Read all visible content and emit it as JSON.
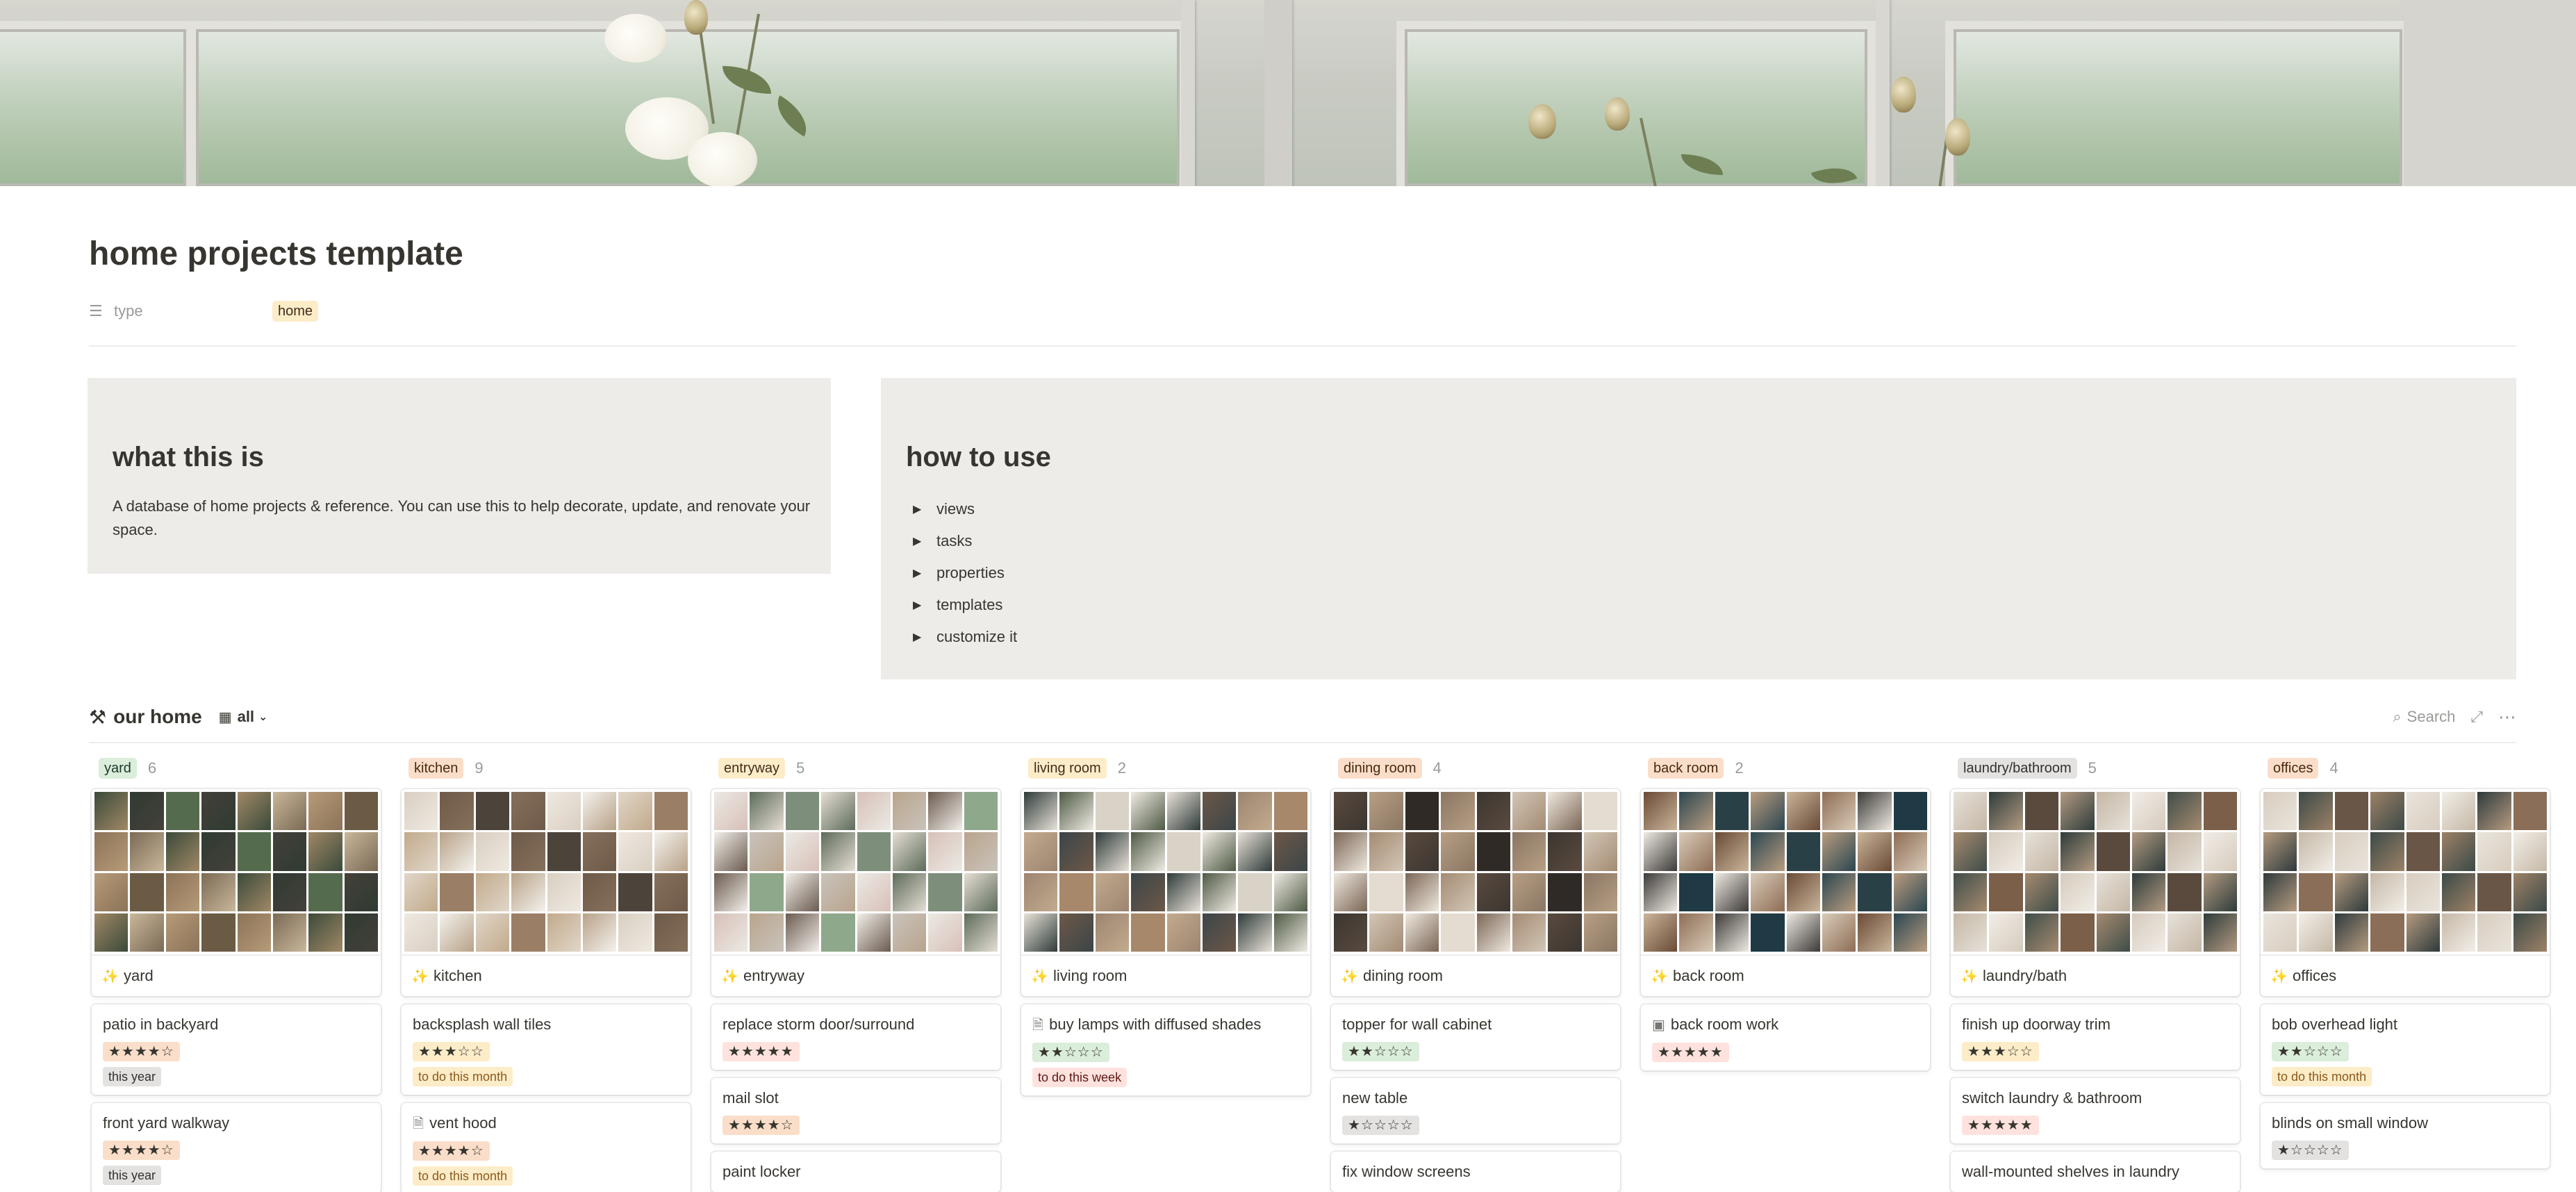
{
  "page": {
    "title": "home projects template",
    "property": {
      "label": "type",
      "value": "home",
      "icon": "list-icon"
    }
  },
  "what_this_is": {
    "heading": "what this is",
    "body": "A database of home projects & reference. You can use this to help decorate, update, and renovate your space."
  },
  "how_to_use": {
    "heading": "how to use",
    "items": [
      "views",
      "tasks",
      "properties",
      "templates",
      "customize it"
    ]
  },
  "database": {
    "title": "our home",
    "icon": "wrench-icon",
    "view_label": "all",
    "search_label": "Search",
    "columns": [
      {
        "name": "yard",
        "count": "6",
        "color": "#dbeddb",
        "text_color": "#1c3829",
        "card_title": "yard",
        "tasks": [
          {
            "name": "patio in backyard",
            "stars": "★★★★☆",
            "star_bg": "#fadec9",
            "badge": "this year",
            "badge_bg": "#e3e2e0",
            "badge_color": "#32302c"
          },
          {
            "name": "front yard walkway",
            "stars": "★★★★☆",
            "star_bg": "#fadec9",
            "badge": "this year",
            "badge_bg": "#e3e2e0",
            "badge_color": "#32302c"
          }
        ]
      },
      {
        "name": "kitchen",
        "count": "9",
        "color": "#fadec9",
        "text_color": "#49290e",
        "card_title": "kitchen",
        "tasks": [
          {
            "name": "backsplash wall tiles",
            "stars": "★★★☆☆",
            "star_bg": "#fdecc8",
            "badge": "to do this month",
            "badge_bg": "#fdecc8",
            "badge_color": "#8a5a1c"
          },
          {
            "name": "vent hood",
            "page_icon": "page-icon",
            "stars": "★★★★☆",
            "star_bg": "#fadec9",
            "badge": "to do this month",
            "badge_bg": "#fdecc8",
            "badge_color": "#8a5a1c"
          }
        ]
      },
      {
        "name": "entryway",
        "count": "5",
        "color": "#fdecc8",
        "text_color": "#402c1b",
        "card_title": "entryway",
        "tasks": [
          {
            "name": "replace storm door/surround",
            "stars": "★★★★★",
            "star_bg": "#ffe2dd",
            "badge": "",
            "badge_bg": "",
            "badge_color": ""
          },
          {
            "name": "mail slot",
            "stars": "★★★★☆",
            "star_bg": "#fadec9",
            "badge": "",
            "badge_bg": "",
            "badge_color": ""
          },
          {
            "name": "paint locker",
            "stars": "",
            "star_bg": "",
            "badge": "",
            "badge_bg": "",
            "badge_color": ""
          }
        ]
      },
      {
        "name": "living room",
        "count": "2",
        "color": "#fdecc8",
        "text_color": "#402c1b",
        "card_title": "living room",
        "tasks": [
          {
            "name": "buy lamps with diffused shades",
            "page_icon": "page-icon",
            "stars": "★★☆☆☆",
            "star_bg": "#dbeddb",
            "badge": "to do this week",
            "badge_bg": "#ffe2dd",
            "badge_color": "#5d1715"
          }
        ]
      },
      {
        "name": "dining room",
        "count": "4",
        "color": "#fadec9",
        "text_color": "#49290e",
        "card_title": "dining room",
        "tasks": [
          {
            "name": "topper for wall cabinet",
            "stars": "★★☆☆☆",
            "star_bg": "#dbeddb",
            "badge": "",
            "badge_bg": "",
            "badge_color": ""
          },
          {
            "name": "new table",
            "stars": "★☆☆☆☆",
            "star_bg": "#e3e2e0",
            "badge": "",
            "badge_bg": "",
            "badge_color": ""
          },
          {
            "name": "fix window screens",
            "stars": "",
            "star_bg": "",
            "badge": "",
            "badge_bg": "",
            "badge_color": ""
          }
        ]
      },
      {
        "name": "back room",
        "count": "2",
        "color": "#fadec9",
        "text_color": "#49290e",
        "card_title": "back room",
        "tasks": [
          {
            "name": "back room work",
            "page_icon": "image-icon",
            "stars": "★★★★★",
            "star_bg": "#ffe2dd",
            "badge": "",
            "badge_bg": "",
            "badge_color": ""
          }
        ]
      },
      {
        "name": "laundry/bathroom",
        "count": "5",
        "color": "#e3e2e0",
        "text_color": "#32302c",
        "card_title": "laundry/bath",
        "tasks": [
          {
            "name": "finish up doorway trim",
            "stars": "★★★☆☆",
            "star_bg": "#fdecc8",
            "badge": "",
            "badge_bg": "",
            "badge_color": ""
          },
          {
            "name": "switch laundry & bathroom",
            "stars": "★★★★★",
            "star_bg": "#ffe2dd",
            "badge": "",
            "badge_bg": "",
            "badge_color": ""
          },
          {
            "name": "wall-mounted shelves in laundry",
            "stars": "",
            "star_bg": "",
            "badge": "",
            "badge_bg": "",
            "badge_color": ""
          }
        ]
      },
      {
        "name": "offices",
        "count": "4",
        "color": "#fadec9",
        "text_color": "#49290e",
        "card_title": "offices",
        "tasks": [
          {
            "name": "bob overhead light",
            "stars": "★★☆☆☆",
            "star_bg": "#dbeddb",
            "badge": "to do this month",
            "badge_bg": "#fdecc8",
            "badge_color": "#8a5a1c"
          },
          {
            "name": "blinds on small window",
            "stars": "★☆☆☆☆",
            "star_bg": "#e3e2e0",
            "badge": "",
            "badge_bg": "",
            "badge_color": ""
          }
        ]
      }
    ]
  }
}
